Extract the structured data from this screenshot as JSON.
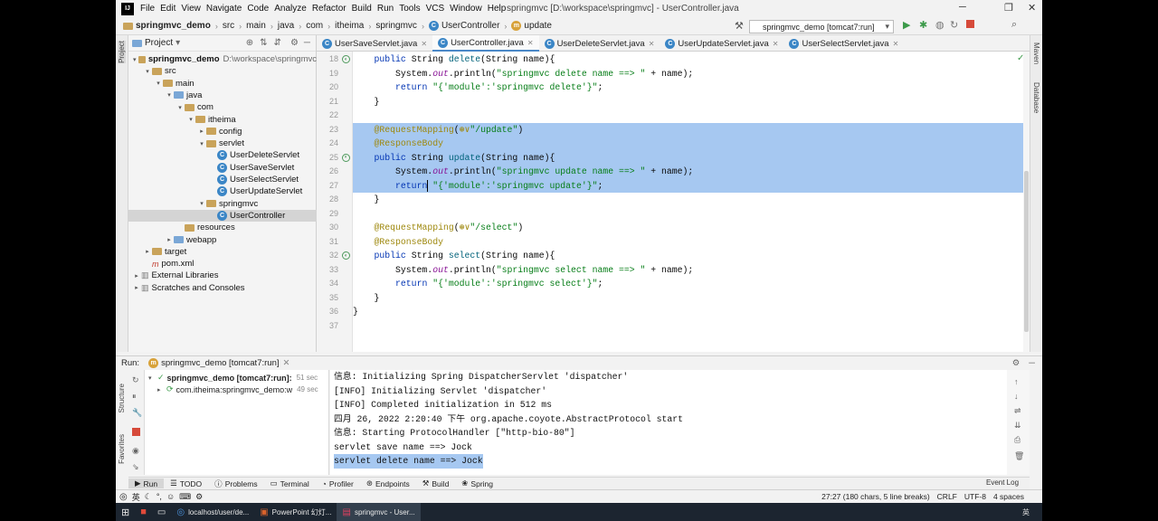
{
  "menubar": {
    "logo": "IJ",
    "items": [
      "File",
      "Edit",
      "View",
      "Navigate",
      "Code",
      "Analyze",
      "Refactor",
      "Build",
      "Run",
      "Tools",
      "VCS",
      "Window",
      "Help"
    ],
    "title": "springmvc [D:\\workspace\\springmvc] - UserController.java"
  },
  "breadcrumb": [
    "springmvc_demo",
    "src",
    "main",
    "java",
    "com",
    "itheima",
    "springmvc",
    "UserController",
    "update"
  ],
  "run_config": "springmvc_demo [tomcat7:run]",
  "project_panel": {
    "title": "Project",
    "tree": [
      {
        "label": "springmvc_demo",
        "extra": "D:\\workspace\\springmvc",
        "icon": "folder",
        "arrow": "▾",
        "indent": 0,
        "bold": true
      },
      {
        "label": "src",
        "icon": "folder",
        "arrow": "▾",
        "indent": 1
      },
      {
        "label": "main",
        "icon": "folder",
        "arrow": "▾",
        "indent": 2
      },
      {
        "label": "java",
        "icon": "folder-blue",
        "arrow": "▾",
        "indent": 3
      },
      {
        "label": "com",
        "icon": "folder",
        "arrow": "▾",
        "indent": 4
      },
      {
        "label": "itheima",
        "icon": "folder",
        "arrow": "▾",
        "indent": 5
      },
      {
        "label": "config",
        "icon": "folder",
        "arrow": "▸",
        "indent": 6
      },
      {
        "label": "servlet",
        "icon": "folder",
        "arrow": "▾",
        "indent": 6
      },
      {
        "label": "UserDeleteServlet",
        "icon": "class",
        "arrow": "",
        "indent": 7
      },
      {
        "label": "UserSaveServlet",
        "icon": "class",
        "arrow": "",
        "indent": 7
      },
      {
        "label": "UserSelectServlet",
        "icon": "class",
        "arrow": "",
        "indent": 7
      },
      {
        "label": "UserUpdateServlet",
        "icon": "class",
        "arrow": "",
        "indent": 7
      },
      {
        "label": "springmvc",
        "icon": "folder",
        "arrow": "▾",
        "indent": 6
      },
      {
        "label": "UserController",
        "icon": "class",
        "arrow": "",
        "indent": 7,
        "selected": true
      },
      {
        "label": "resources",
        "icon": "folder",
        "arrow": "",
        "indent": 4
      },
      {
        "label": "webapp",
        "icon": "folder-blue",
        "arrow": "▸",
        "indent": 3
      },
      {
        "label": "target",
        "icon": "folder",
        "arrow": "▸",
        "indent": 1
      },
      {
        "label": "pom.xml",
        "icon": "maven",
        "arrow": "",
        "indent": 1
      },
      {
        "label": "External Libraries",
        "icon": "lib",
        "arrow": "▸",
        "indent": 0
      },
      {
        "label": "Scratches and Consoles",
        "icon": "lib",
        "arrow": "▸",
        "indent": 0
      }
    ]
  },
  "tabs": [
    {
      "label": "UserSaveServlet.java",
      "active": false
    },
    {
      "label": "UserController.java",
      "active": true
    },
    {
      "label": "UserDeleteServlet.java",
      "active": false
    },
    {
      "label": "UserUpdateServlet.java",
      "active": false
    },
    {
      "label": "UserSelectServlet.java",
      "active": false
    }
  ],
  "code": [
    {
      "n": "18",
      "gicon": true,
      "hl": false,
      "segs": [
        [
          "    ",
          ""
        ],
        [
          "public ",
          "kw"
        ],
        [
          "String ",
          ""
        ],
        [
          "delete",
          "fn"
        ],
        [
          "(String name){",
          ""
        ]
      ]
    },
    {
      "n": "19",
      "hl": false,
      "segs": [
        [
          "        System.",
          ""
        ],
        [
          "out",
          "it"
        ],
        [
          ".println(",
          ""
        ],
        [
          "\"springmvc delete name ==> \"",
          "str"
        ],
        [
          " + name);",
          ""
        ]
      ]
    },
    {
      "n": "20",
      "hl": false,
      "segs": [
        [
          "        ",
          ""
        ],
        [
          "return ",
          "kw"
        ],
        [
          "\"{'module':'springmvc delete'}\"",
          "str"
        ],
        [
          ";",
          ""
        ]
      ]
    },
    {
      "n": "21",
      "hl": false,
      "segs": [
        [
          "    }",
          ""
        ]
      ]
    },
    {
      "n": "22",
      "hl": false,
      "segs": [
        [
          "",
          ""
        ]
      ]
    },
    {
      "n": "23",
      "hl": true,
      "segs": [
        [
          "    ",
          ""
        ],
        [
          "@RequestMapping",
          "ann"
        ],
        [
          "(",
          ""
        ],
        [
          "⊛∨",
          "ann"
        ],
        [
          "\"/update\"",
          "str"
        ],
        [
          ")",
          ""
        ]
      ]
    },
    {
      "n": "24",
      "hl": true,
      "segs": [
        [
          "    ",
          ""
        ],
        [
          "@ResponseBody",
          "ann"
        ]
      ]
    },
    {
      "n": "25",
      "gicon": true,
      "hl": true,
      "segs": [
        [
          "    ",
          ""
        ],
        [
          "public ",
          "kw"
        ],
        [
          "String ",
          ""
        ],
        [
          "update",
          "fn"
        ],
        [
          "(String name){",
          ""
        ]
      ]
    },
    {
      "n": "26",
      "hl": true,
      "segs": [
        [
          "        System.",
          ""
        ],
        [
          "out",
          "it"
        ],
        [
          ".println(",
          ""
        ],
        [
          "\"springmvc update name ==> \"",
          "str"
        ],
        [
          " + name);",
          ""
        ]
      ]
    },
    {
      "n": "27",
      "hl": true,
      "segs": [
        [
          "        ",
          ""
        ],
        [
          "return ",
          "kw"
        ],
        [
          "\"{'module':'springmvc update'}\"",
          "str"
        ],
        [
          ";",
          ""
        ]
      ]
    },
    {
      "n": "28",
      "hl": false,
      "segs": [
        [
          "    }",
          ""
        ]
      ]
    },
    {
      "n": "29",
      "hl": false,
      "segs": [
        [
          "",
          ""
        ]
      ]
    },
    {
      "n": "30",
      "hl": false,
      "segs": [
        [
          "    ",
          ""
        ],
        [
          "@RequestMapping",
          "ann"
        ],
        [
          "(",
          ""
        ],
        [
          "⊛∨",
          "ann"
        ],
        [
          "\"/select\"",
          "str"
        ],
        [
          ")",
          ""
        ]
      ]
    },
    {
      "n": "31",
      "hl": false,
      "segs": [
        [
          "    ",
          ""
        ],
        [
          "@ResponseBody",
          "ann"
        ]
      ]
    },
    {
      "n": "32",
      "gicon": true,
      "hl": false,
      "segs": [
        [
          "    ",
          ""
        ],
        [
          "public ",
          "kw"
        ],
        [
          "String ",
          ""
        ],
        [
          "select",
          "fn"
        ],
        [
          "(String name){",
          ""
        ]
      ]
    },
    {
      "n": "33",
      "hl": false,
      "segs": [
        [
          "        System.",
          ""
        ],
        [
          "out",
          "it"
        ],
        [
          ".println(",
          ""
        ],
        [
          "\"springmvc select name ==> \"",
          "str"
        ],
        [
          " + name);",
          ""
        ]
      ]
    },
    {
      "n": "34",
      "hl": false,
      "segs": [
        [
          "        ",
          ""
        ],
        [
          "return ",
          "kw"
        ],
        [
          "\"{'module':'springmvc select'}\"",
          "str"
        ],
        [
          ";",
          ""
        ]
      ]
    },
    {
      "n": "35",
      "hl": false,
      "segs": [
        [
          "    }",
          ""
        ]
      ]
    },
    {
      "n": "36",
      "hl": false,
      "segs": [
        [
          "}",
          ""
        ]
      ]
    },
    {
      "n": "37",
      "hl": false,
      "segs": [
        [
          "",
          ""
        ]
      ]
    }
  ],
  "run_panel": {
    "label": "Run:",
    "tab": "springmvc_demo [tomcat7:run]",
    "tree": [
      {
        "label": "springmvc_demo [tomcat7:run]:",
        "time": "51 sec",
        "bold": true
      },
      {
        "label": "com.itheima:springmvc_demo:w",
        "time": "49 sec",
        "bold": false
      }
    ],
    "console": [
      {
        "text": "信息: Initializing Spring DispatcherServlet 'dispatcher'",
        "sel": false
      },
      {
        "text": "[INFO] Initializing Servlet 'dispatcher'",
        "sel": false
      },
      {
        "text": "[INFO] Completed initialization in 512 ms",
        "sel": false
      },
      {
        "text": "四月 26, 2022 2:20:40 下午 org.apache.coyote.AbstractProtocol start",
        "sel": false
      },
      {
        "text": "信息: Starting ProtocolHandler [\"http-bio-80\"]",
        "sel": false
      },
      {
        "text": "servlet save name ==> Jock",
        "sel": false
      },
      {
        "text": "servlet delete name ==> Jock",
        "sel": true
      }
    ]
  },
  "bottom_tools": [
    {
      "label": "Run",
      "active": true
    },
    {
      "label": "TODO",
      "active": false
    },
    {
      "label": "Problems",
      "active": false
    },
    {
      "label": "Terminal",
      "active": false
    },
    {
      "label": "Profiler",
      "active": false
    },
    {
      "label": "Endpoints",
      "active": false
    },
    {
      "label": "Build",
      "active": false
    },
    {
      "label": "Spring",
      "active": false
    }
  ],
  "side_labels": {
    "project": "Project",
    "structure": "Structure",
    "favorites": "Favorites",
    "maven": "Maven",
    "database": "Database"
  },
  "event_log": "Event Log",
  "status": {
    "ime": "英",
    "position": "27:27 (180 chars, 5 line breaks)",
    "line_sep": "CRLF",
    "encoding": "UTF-8",
    "indent": "4 spaces"
  },
  "taskbar": {
    "items": [
      {
        "label": "localhost/user/de...",
        "open": false
      },
      {
        "label": "PowerPoint 幻灯...",
        "open": false
      },
      {
        "label": "springmvc - User...",
        "open": true
      }
    ],
    "ime": "英"
  },
  "colors": {
    "selection": "#a6c8f1",
    "keyword": "#0033b3",
    "string": "#067d17",
    "annotation": "#9e880d"
  }
}
